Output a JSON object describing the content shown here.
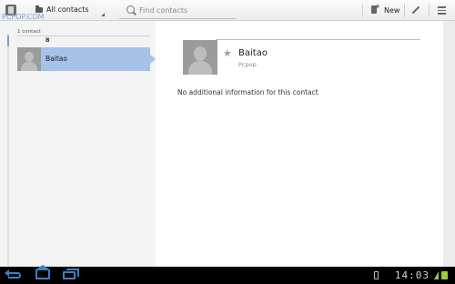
{
  "watermark": "PCPOP.COM",
  "action_bar": {
    "filter": {
      "label": "All contacts"
    },
    "search": {
      "placeholder": "Find contacts",
      "value": ""
    },
    "new_button": {
      "label": "New",
      "icon": "new-contact-icon"
    },
    "edit_icon": "pencil-icon",
    "overflow_icon": "menu-icon"
  },
  "contact_list": {
    "count_label": "1 contact",
    "section_header": "B",
    "items": [
      {
        "name": "Baitao",
        "selected": true
      }
    ]
  },
  "contact_detail": {
    "name": "Baitao",
    "organization": "Pcpop",
    "starred": false,
    "empty_message": "No additional information for this contact"
  },
  "system_bar": {
    "clock": "14:03",
    "icons": [
      "back-icon",
      "home-icon",
      "recent-apps-icon",
      "usb-icon",
      "wifi-icon",
      "battery-icon"
    ]
  },
  "colors": {
    "selection": "#a7c2e9",
    "nav_accent": "#3f7fc7",
    "status_green": "#9ccc3a"
  }
}
